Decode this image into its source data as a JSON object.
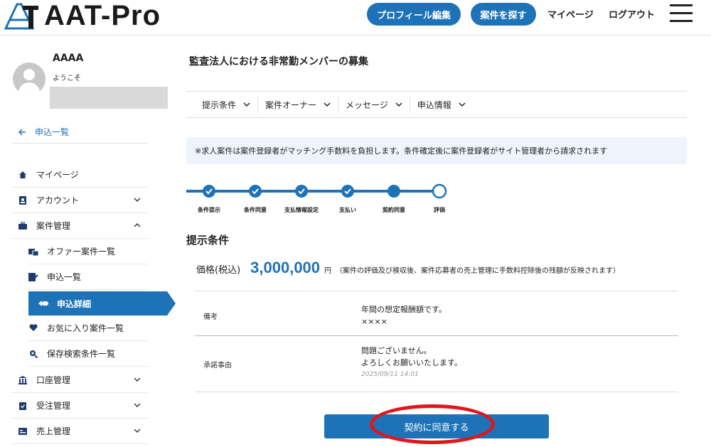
{
  "header": {
    "logo_text": "AAT-Pro",
    "profile_edit": "プロフィール編集",
    "find_jobs": "案件を探す",
    "mypage": "マイページ",
    "logout": "ログアウト",
    "icons": {
      "logo": "logo-icon",
      "menu": "hamburger-menu-icon"
    }
  },
  "sidebar": {
    "user_name": "AAAA",
    "greeting": "ようこそ",
    "back_link": "申込一覧",
    "items": [
      {
        "label": "マイページ",
        "icon": "home-icon"
      },
      {
        "label": "アカウント",
        "icon": "account-icon",
        "expand": "down"
      },
      {
        "label": "案件管理",
        "icon": "briefcase-icon",
        "expand": "up"
      }
    ],
    "sub_items": [
      {
        "label": "オファー案件一覧",
        "icon": "offer-icon"
      },
      {
        "label": "申込一覧",
        "icon": "application-icon"
      },
      {
        "label": "申込詳細",
        "icon": "detail-icon",
        "active": true
      },
      {
        "label": "お気に入り案件一覧",
        "icon": "heart-icon"
      },
      {
        "label": "保存検索条件一覧",
        "icon": "saved-search-icon"
      }
    ],
    "bottom_items": [
      {
        "label": "口座管理",
        "icon": "bank-icon"
      },
      {
        "label": "受注管理",
        "icon": "order-icon"
      },
      {
        "label": "売上管理",
        "icon": "sales-icon"
      }
    ]
  },
  "main": {
    "title": "監査法人における非常勤メンバーの募集",
    "tabs": [
      "提示条件",
      "案件オーナー",
      "メッセージ",
      "申込情報"
    ],
    "notice": "※求人案件は案件登録者がマッチング手数料を負担します。条件確定後に案件登録者がサイト管理者から請求されます",
    "steps": [
      "条件提示",
      "条件同意",
      "支払情報設定",
      "支払い",
      "契約同意",
      "評価"
    ],
    "steps_completed": 5,
    "section_title": "提示条件",
    "price_label": "価格(税込)",
    "price_value": "3,000,000",
    "price_unit": "円",
    "price_note": "（案件の評価及び検収後、案件応募者の売上管理に手数料控除後の残額が反映されます）",
    "remarks_label": "備考",
    "remarks_line1": "年間の想定報酬額です。",
    "remarks_line2": "××××",
    "approval_label": "承諾事由",
    "approval_line1": "問題ございません。",
    "approval_line2": "よろしくお願いいたします。",
    "approval_ts": "2025/09/11 14:01",
    "agree_button": "契約に同意する"
  },
  "colors": {
    "accent": "#1e73b8",
    "highlight": "#e4141b"
  }
}
